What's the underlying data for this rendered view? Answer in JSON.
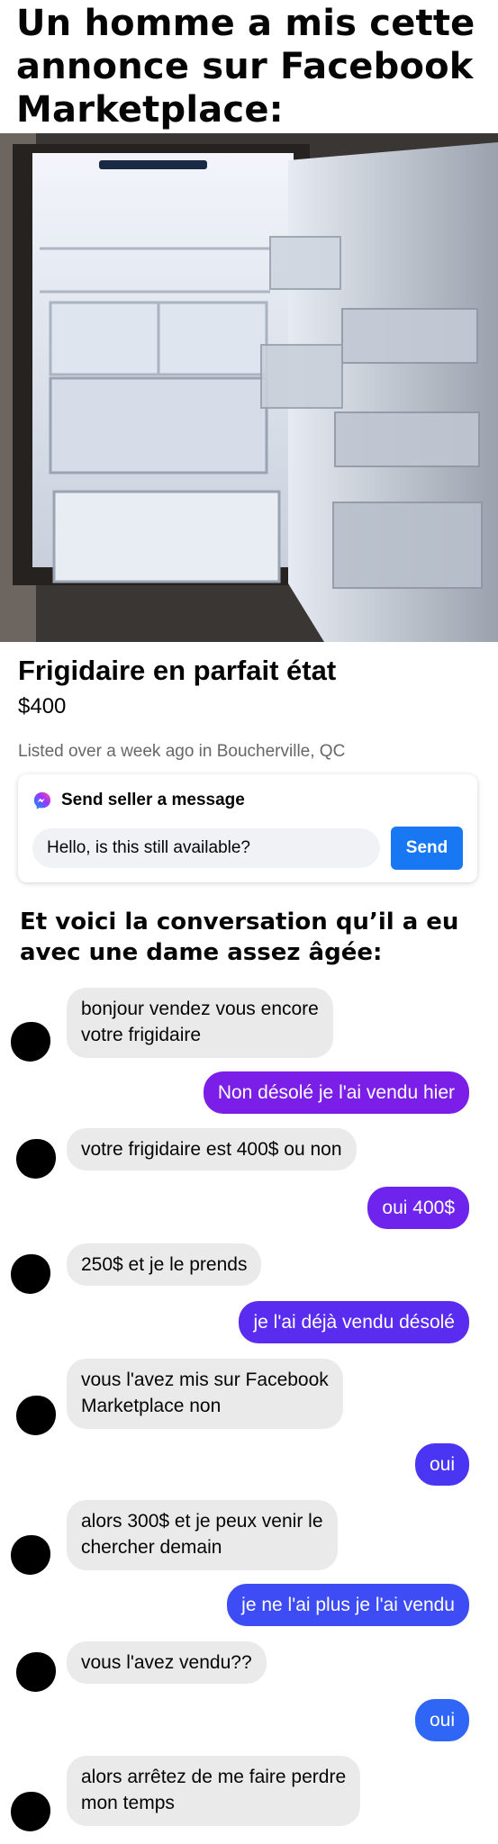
{
  "meme": {
    "title": "Un homme a mis cette\nannonce sur Facebook\nMarketplace:",
    "subtitle": "Et voici la conversation qu’il a eu\navec une dame assez âgée:"
  },
  "listing": {
    "title": "Frigidaire en parfait état",
    "price": "$400",
    "meta": "Listed over a week ago in Boucherville, QC",
    "message_heading": "Send seller a message",
    "message_value": "Hello, is this still available?",
    "send_label": "Send",
    "send_color": "#1877f2"
  },
  "conversation": {
    "incoming_color": "#eaeaea",
    "messages": [
      {
        "from": "buyer",
        "text": "bonjour vendez vous encore\nvotre frigidaire"
      },
      {
        "from": "seller",
        "text": "Non désolé je l'ai vendu hier",
        "color": "#7b1fe8"
      },
      {
        "from": "buyer",
        "text": "votre frigidaire est 400$ ou non"
      },
      {
        "from": "seller",
        "text": "oui 400$",
        "color": "#6e24ec"
      },
      {
        "from": "buyer",
        "text": "250$ et je le prends"
      },
      {
        "from": "seller",
        "text": "je l'ai déjà vendu désolé",
        "color": "#5a2cf0"
      },
      {
        "from": "buyer",
        "text": "vous l'avez mis sur Facebook\nMarketplace non"
      },
      {
        "from": "seller",
        "text": "oui",
        "color": "#4a35f2"
      },
      {
        "from": "buyer",
        "text": "alors 300$ et je peux venir le\nchercher demain"
      },
      {
        "from": "seller",
        "text": "je ne l'ai plus je l'ai vendu",
        "color": "#3d4cf5"
      },
      {
        "from": "buyer",
        "text": "vous l'avez vendu??"
      },
      {
        "from": "seller",
        "text": "oui",
        "color": "#2f66f6"
      },
      {
        "from": "buyer",
        "text": "alors arrêtez de me faire perdre\nmon temps"
      }
    ]
  }
}
